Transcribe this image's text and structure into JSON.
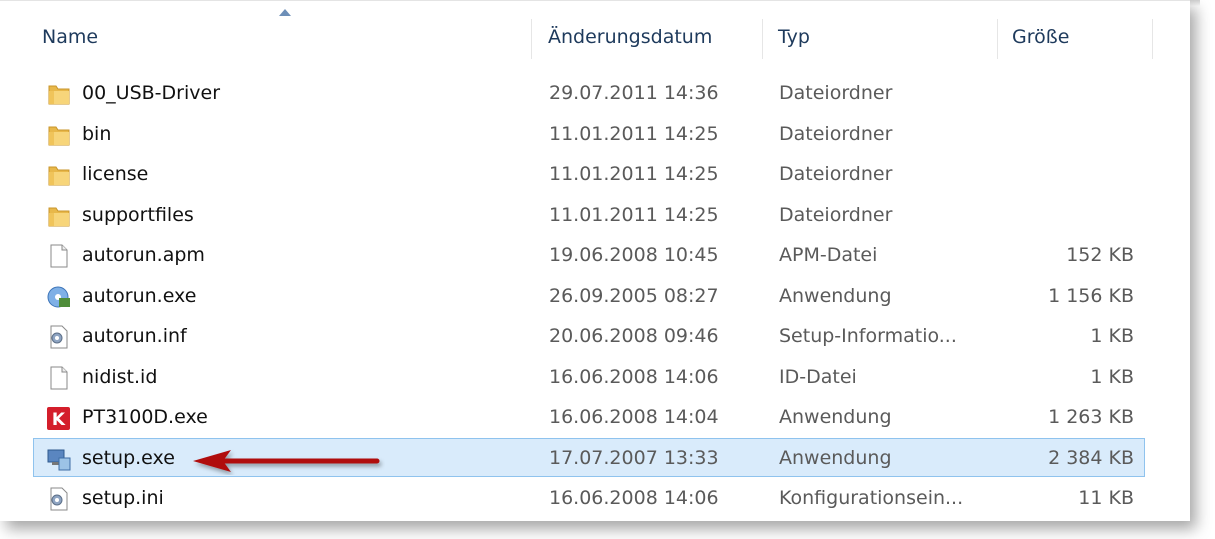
{
  "columns": {
    "name": "Name",
    "date": "Änderungsdatum",
    "type": "Typ",
    "size": "Größe"
  },
  "files": [
    {
      "name": "00_USB-Driver",
      "date": "29.07.2011 14:36",
      "type": "Dateiordner",
      "size": "",
      "icon": "folder-icon"
    },
    {
      "name": "bin",
      "date": "11.01.2011 14:25",
      "type": "Dateiordner",
      "size": "",
      "icon": "folder-icon"
    },
    {
      "name": "license",
      "date": "11.01.2011 14:25",
      "type": "Dateiordner",
      "size": "",
      "icon": "folder-icon"
    },
    {
      "name": "supportfiles",
      "date": "11.01.2011 14:25",
      "type": "Dateiordner",
      "size": "",
      "icon": "folder-icon"
    },
    {
      "name": "autorun.apm",
      "date": "19.06.2008 10:45",
      "type": "APM-Datei",
      "size": "152 KB",
      "icon": "blank-file-icon"
    },
    {
      "name": "autorun.exe",
      "date": "26.09.2005 08:27",
      "type": "Anwendung",
      "size": "1 156 KB",
      "icon": "installer-disc-icon"
    },
    {
      "name": "autorun.inf",
      "date": "20.06.2008 09:46",
      "type": "Setup-Informatio...",
      "size": "1 KB",
      "icon": "settings-file-icon"
    },
    {
      "name": "nidist.id",
      "date": "16.06.2008 14:06",
      "type": "ID-Datei",
      "size": "1 KB",
      "icon": "blank-file-icon"
    },
    {
      "name": "PT3100D.exe",
      "date": "16.06.2008 14:04",
      "type": "Anwendung",
      "size": "1 263 KB",
      "icon": "red-k-app-icon"
    },
    {
      "name": "setup.exe",
      "date": "17.07.2007 13:33",
      "type": "Anwendung",
      "size": "2 384 KB",
      "icon": "setup-computer-icon",
      "selected": true
    },
    {
      "name": "setup.ini",
      "date": "16.06.2008 14:06",
      "type": "Konfigurationsein...",
      "size": "11 KB",
      "icon": "settings-file-icon"
    }
  ],
  "colors": {
    "selection_bg": "#d9ebfb",
    "selection_border": "#8fc3ee",
    "arrow": "#b01010",
    "header_text": "#1e3a5c"
  },
  "annotation": "red-arrow-pointing-at-setup-exe"
}
